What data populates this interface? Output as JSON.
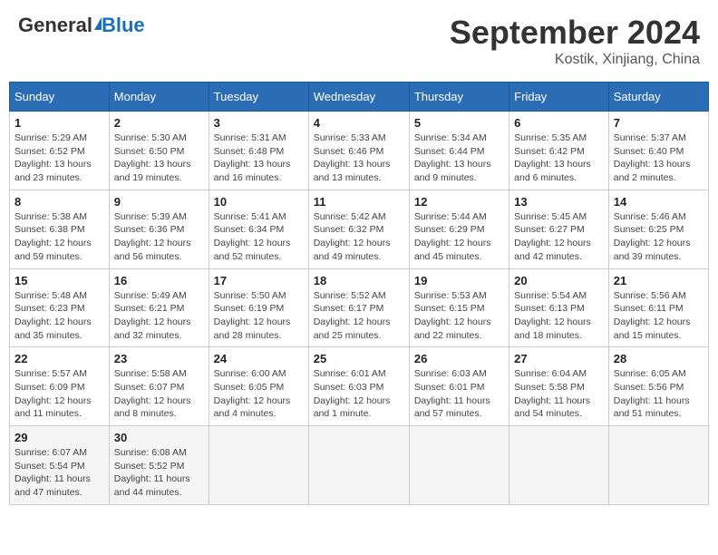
{
  "header": {
    "logo_general": "General",
    "logo_blue": "Blue",
    "month_title": "September 2024",
    "location": "Kostik, Xinjiang, China"
  },
  "calendar": {
    "days_of_week": [
      "Sunday",
      "Monday",
      "Tuesday",
      "Wednesday",
      "Thursday",
      "Friday",
      "Saturday"
    ],
    "weeks": [
      [
        {
          "day": "1",
          "detail": "Sunrise: 5:29 AM\nSunset: 6:52 PM\nDaylight: 13 hours\nand 23 minutes."
        },
        {
          "day": "2",
          "detail": "Sunrise: 5:30 AM\nSunset: 6:50 PM\nDaylight: 13 hours\nand 19 minutes."
        },
        {
          "day": "3",
          "detail": "Sunrise: 5:31 AM\nSunset: 6:48 PM\nDaylight: 13 hours\nand 16 minutes."
        },
        {
          "day": "4",
          "detail": "Sunrise: 5:33 AM\nSunset: 6:46 PM\nDaylight: 13 hours\nand 13 minutes."
        },
        {
          "day": "5",
          "detail": "Sunrise: 5:34 AM\nSunset: 6:44 PM\nDaylight: 13 hours\nand 9 minutes."
        },
        {
          "day": "6",
          "detail": "Sunrise: 5:35 AM\nSunset: 6:42 PM\nDaylight: 13 hours\nand 6 minutes."
        },
        {
          "day": "7",
          "detail": "Sunrise: 5:37 AM\nSunset: 6:40 PM\nDaylight: 13 hours\nand 2 minutes."
        }
      ],
      [
        {
          "day": "8",
          "detail": "Sunrise: 5:38 AM\nSunset: 6:38 PM\nDaylight: 12 hours\nand 59 minutes."
        },
        {
          "day": "9",
          "detail": "Sunrise: 5:39 AM\nSunset: 6:36 PM\nDaylight: 12 hours\nand 56 minutes."
        },
        {
          "day": "10",
          "detail": "Sunrise: 5:41 AM\nSunset: 6:34 PM\nDaylight: 12 hours\nand 52 minutes."
        },
        {
          "day": "11",
          "detail": "Sunrise: 5:42 AM\nSunset: 6:32 PM\nDaylight: 12 hours\nand 49 minutes."
        },
        {
          "day": "12",
          "detail": "Sunrise: 5:44 AM\nSunset: 6:29 PM\nDaylight: 12 hours\nand 45 minutes."
        },
        {
          "day": "13",
          "detail": "Sunrise: 5:45 AM\nSunset: 6:27 PM\nDaylight: 12 hours\nand 42 minutes."
        },
        {
          "day": "14",
          "detail": "Sunrise: 5:46 AM\nSunset: 6:25 PM\nDaylight: 12 hours\nand 39 minutes."
        }
      ],
      [
        {
          "day": "15",
          "detail": "Sunrise: 5:48 AM\nSunset: 6:23 PM\nDaylight: 12 hours\nand 35 minutes."
        },
        {
          "day": "16",
          "detail": "Sunrise: 5:49 AM\nSunset: 6:21 PM\nDaylight: 12 hours\nand 32 minutes."
        },
        {
          "day": "17",
          "detail": "Sunrise: 5:50 AM\nSunset: 6:19 PM\nDaylight: 12 hours\nand 28 minutes."
        },
        {
          "day": "18",
          "detail": "Sunrise: 5:52 AM\nSunset: 6:17 PM\nDaylight: 12 hours\nand 25 minutes."
        },
        {
          "day": "19",
          "detail": "Sunrise: 5:53 AM\nSunset: 6:15 PM\nDaylight: 12 hours\nand 22 minutes."
        },
        {
          "day": "20",
          "detail": "Sunrise: 5:54 AM\nSunset: 6:13 PM\nDaylight: 12 hours\nand 18 minutes."
        },
        {
          "day": "21",
          "detail": "Sunrise: 5:56 AM\nSunset: 6:11 PM\nDaylight: 12 hours\nand 15 minutes."
        }
      ],
      [
        {
          "day": "22",
          "detail": "Sunrise: 5:57 AM\nSunset: 6:09 PM\nDaylight: 12 hours\nand 11 minutes."
        },
        {
          "day": "23",
          "detail": "Sunrise: 5:58 AM\nSunset: 6:07 PM\nDaylight: 12 hours\nand 8 minutes."
        },
        {
          "day": "24",
          "detail": "Sunrise: 6:00 AM\nSunset: 6:05 PM\nDaylight: 12 hours\nand 4 minutes."
        },
        {
          "day": "25",
          "detail": "Sunrise: 6:01 AM\nSunset: 6:03 PM\nDaylight: 12 hours\nand 1 minute."
        },
        {
          "day": "26",
          "detail": "Sunrise: 6:03 AM\nSunset: 6:01 PM\nDaylight: 11 hours\nand 57 minutes."
        },
        {
          "day": "27",
          "detail": "Sunrise: 6:04 AM\nSunset: 5:58 PM\nDaylight: 11 hours\nand 54 minutes."
        },
        {
          "day": "28",
          "detail": "Sunrise: 6:05 AM\nSunset: 5:56 PM\nDaylight: 11 hours\nand 51 minutes."
        }
      ],
      [
        {
          "day": "29",
          "detail": "Sunrise: 6:07 AM\nSunset: 5:54 PM\nDaylight: 11 hours\nand 47 minutes."
        },
        {
          "day": "30",
          "detail": "Sunrise: 6:08 AM\nSunset: 5:52 PM\nDaylight: 11 hours\nand 44 minutes."
        },
        {
          "day": "",
          "detail": ""
        },
        {
          "day": "",
          "detail": ""
        },
        {
          "day": "",
          "detail": ""
        },
        {
          "day": "",
          "detail": ""
        },
        {
          "day": "",
          "detail": ""
        }
      ]
    ]
  }
}
